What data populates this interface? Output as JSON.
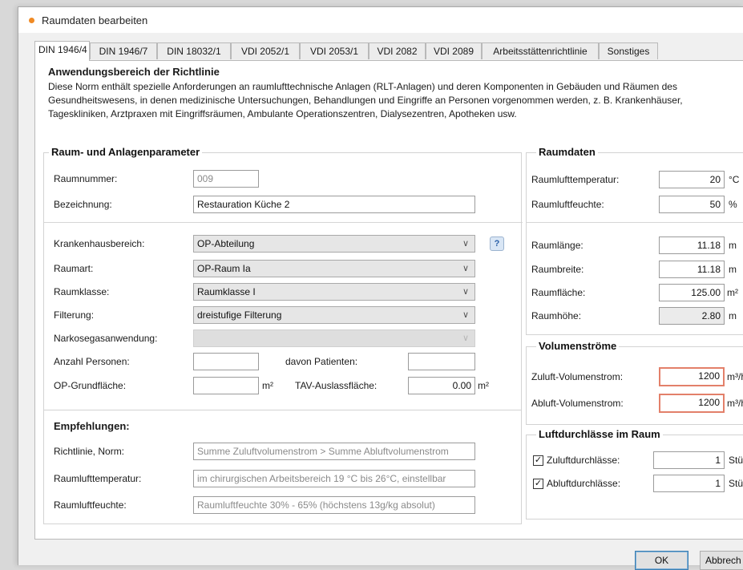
{
  "window": {
    "title": "Raumdaten bearbeiten"
  },
  "tabs": [
    {
      "label": "DIN 1946/4",
      "active": true
    },
    {
      "label": "DIN 1946/7"
    },
    {
      "label": "DIN 18032/1"
    },
    {
      "label": "VDI 2052/1"
    },
    {
      "label": "VDI 2053/1"
    },
    {
      "label": "VDI 2082"
    },
    {
      "label": "VDI 2089"
    },
    {
      "label": "Arbeitsstättenrichtlinie"
    },
    {
      "label": "Sonstiges"
    }
  ],
  "tab_scroll_glyph": "◂",
  "scope": {
    "title": "Anwendungsbereich der Richtlinie",
    "text": "Diese Norm enthält spezielle Anforderungen an raumlufttechnische Anlagen (RLT-Anlagen) und deren Komponenten in Gebäuden und Räumen des Gesundheitswesens, in denen medizinische Untersuchungen, Behandlungen und Eingriffe an Personen vorgenommen werden, z. B. Krankenhäuser, Tageskliniken, Arztpraxen mit Eingriffsräumen, Ambulante Operationszentren, Dialysezentren, Apotheken usw."
  },
  "room_params": {
    "title": "Raum- und Anlagenparameter",
    "raumnummer_label": "Raumnummer:",
    "raumnummer_value": "009",
    "bezeichnung_label": "Bezeichnung:",
    "bezeichnung_value": "Restauration Küche 2",
    "krankenhausbereich_label": "Krankenhausbereich:",
    "krankenhausbereich_value": "OP-Abteilung",
    "raumart_label": "Raumart:",
    "raumart_value": "OP-Raum Ia",
    "raumklasse_label": "Raumklasse:",
    "raumklasse_value": "Raumklasse I",
    "filterung_label": "Filterung:",
    "filterung_value": "dreistufige Filterung",
    "narkose_label": "Narkosegasanwendung:",
    "narkose_value": "",
    "personen_label": "Anzahl Personen:",
    "personen_value": "",
    "patienten_label": "davon Patienten:",
    "patienten_value": "",
    "op_flaeche_label": "OP-Grundfläche:",
    "op_flaeche_value": "",
    "op_flaeche_unit": "m²",
    "tav_label": "TAV-Auslassfläche:",
    "tav_value": "0.00",
    "tav_unit": "m²",
    "info_glyph": "?"
  },
  "recommendations": {
    "title": "Empfehlungen:",
    "norm_label": "Richtlinie, Norm:",
    "norm_value": "Summe Zuluftvolumenstrom > Summe Abluftvolumenstrom",
    "temp_label": "Raumlufttemperatur:",
    "temp_value": "im chirurgischen Arbeitsbereich 19 °C bis 26°C, einstellbar",
    "feuchte_label": "Raumluftfeuchte:",
    "feuchte_value": "Raumluftfeuchte 30% - 65% (höchstens 13g/kg absolut)"
  },
  "room_data": {
    "title": "Raumdaten",
    "temp_label": "Raumlufttemperatur:",
    "temp_value": "20",
    "temp_unit": "°C",
    "feuchte_label": "Raumluftfeuchte:",
    "feuchte_value": "50",
    "feuchte_unit": "%",
    "laenge_label": "Raumlänge:",
    "laenge_value": "11.18",
    "laenge_unit": "m",
    "breite_label": "Raumbreite:",
    "breite_value": "11.18",
    "breite_unit": "m",
    "flaeche_label": "Raumfläche:",
    "flaeche_value": "125.00",
    "flaeche_unit": "m²",
    "hoehe_label": "Raumhöhe:",
    "hoehe_value": "2.80",
    "hoehe_unit": "m",
    "calc_glyph": "⚡"
  },
  "volume_flows": {
    "title": "Volumenströme",
    "zuluft_label": "Zuluft-Volumenstrom:",
    "zuluft_value": "1200",
    "zuluft_unit": "m³/h",
    "abluft_label": "Abluft-Volumenstrom:",
    "abluft_value": "1200",
    "abluft_unit": "m³/h"
  },
  "outlets": {
    "title": "Luftdurchlässe im Raum",
    "zuluft_label": "Zuluftdurchlässe:",
    "zuluft_value": "1",
    "zuluft_unit": "Stück",
    "zuluft_checked": true,
    "abluft_label": "Abluftdurchlässe:",
    "abluft_value": "1",
    "abluft_unit": "Stück",
    "abluft_checked": true,
    "check_glyph": "✓"
  },
  "footer": {
    "ok_label": "OK",
    "cancel_label": "Abbrech"
  },
  "colors": {
    "title_dot": "#f08a24",
    "highlight_border": "#e3806a"
  }
}
